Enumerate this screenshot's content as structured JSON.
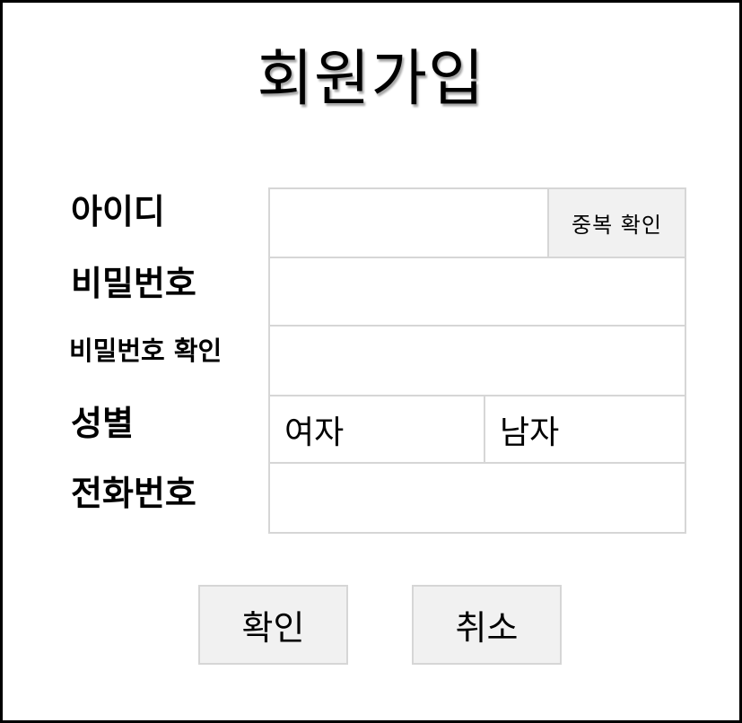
{
  "title": "회원가입",
  "labels": {
    "id": "아이디",
    "password": "비밀번호",
    "password_confirm": "비밀번호 확인",
    "gender": "성별",
    "phone": "전화번호"
  },
  "inputs": {
    "id_value": "",
    "password_value": "",
    "password_confirm_value": "",
    "phone_value": ""
  },
  "duplicate_check_label": "중복 확인",
  "gender_options": [
    "여자",
    "남자"
  ],
  "buttons": {
    "confirm": "확인",
    "cancel": "취소"
  },
  "colors": {
    "border": "#d6d6d6",
    "button_bg": "#f1f1f1",
    "frame_border": "#000000"
  }
}
